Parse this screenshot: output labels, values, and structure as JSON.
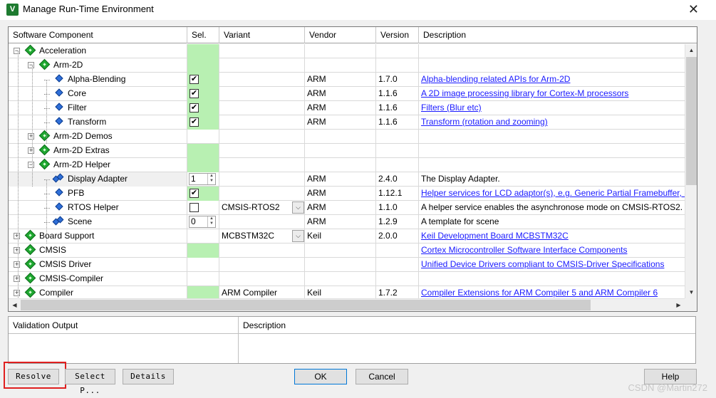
{
  "window": {
    "title": "Manage Run-Time Environment",
    "close_glyph": "✕"
  },
  "columns": [
    "Software Component",
    "Sel.",
    "Variant",
    "Vendor",
    "Version",
    "Description"
  ],
  "rows": [
    {
      "indent": 0,
      "expander": "-",
      "icon": "diamond",
      "name": "Acceleration",
      "sel": "green",
      "variant": "",
      "vendor": "",
      "version": "",
      "desc": "",
      "desc_link": false
    },
    {
      "indent": 1,
      "expander": "-",
      "icon": "diamond",
      "name": "Arm-2D",
      "sel": "green",
      "variant": "",
      "vendor": "",
      "version": "",
      "desc": "",
      "desc_link": false
    },
    {
      "indent": 2,
      "expander": "",
      "icon": "gem",
      "name": "Alpha-Blending",
      "sel": "check",
      "variant": "",
      "vendor": "ARM",
      "version": "1.7.0",
      "desc": "Alpha-blending related APIs for Arm-2D",
      "desc_link": true
    },
    {
      "indent": 2,
      "expander": "",
      "icon": "gem",
      "name": "Core",
      "sel": "check",
      "variant": "",
      "vendor": "ARM",
      "version": "1.1.6",
      "desc": "A 2D image processing library for Cortex-M processors",
      "desc_link": true
    },
    {
      "indent": 2,
      "expander": "",
      "icon": "gem",
      "name": "Filter",
      "sel": "check",
      "variant": "",
      "vendor": "ARM",
      "version": "1.1.6",
      "desc": "Filters (Blur etc)",
      "desc_link": true
    },
    {
      "indent": 2,
      "expander": "",
      "icon": "gem",
      "name": "Transform",
      "sel": "check",
      "variant": "",
      "vendor": "ARM",
      "version": "1.1.6",
      "desc": "Transform (rotation and zooming)",
      "desc_link": true
    },
    {
      "indent": 1,
      "expander": "+",
      "icon": "diamond",
      "name": "Arm-2D Demos",
      "sel": "",
      "variant": "",
      "vendor": "",
      "version": "",
      "desc": "",
      "desc_link": false
    },
    {
      "indent": 1,
      "expander": "+",
      "icon": "diamond",
      "name": "Arm-2D Extras",
      "sel": "green",
      "variant": "",
      "vendor": "",
      "version": "",
      "desc": "",
      "desc_link": false
    },
    {
      "indent": 1,
      "expander": "-",
      "icon": "diamond",
      "name": "Arm-2D Helper",
      "sel": "green",
      "variant": "",
      "vendor": "",
      "version": "",
      "desc": "",
      "desc_link": false
    },
    {
      "indent": 2,
      "expander": "",
      "icon": "gem2",
      "name": "Display Adapter",
      "sel": "spin",
      "spin": "1",
      "variant": "",
      "vendor": "ARM",
      "version": "2.4.0",
      "desc": "The Display Adapter.",
      "desc_link": false,
      "highlight": true
    },
    {
      "indent": 2,
      "expander": "",
      "icon": "gem",
      "name": "PFB",
      "sel": "check",
      "variant": "",
      "vendor": "ARM",
      "version": "1.12.1",
      "desc": "Helper services for LCD adaptor(s), e.g. Generic Partial Framebuffer, Sc",
      "desc_link": true
    },
    {
      "indent": 2,
      "expander": "",
      "icon": "gem",
      "name": "RTOS Helper",
      "sel": "uncheck",
      "variant": "CMSIS-RTOS2",
      "variant_combo": true,
      "vendor": "ARM",
      "version": "1.1.0",
      "desc": "A helper service enables the asynchronose mode on CMSIS-RTOS2.",
      "desc_link": false
    },
    {
      "indent": 2,
      "expander": "",
      "icon": "gem2",
      "name": "Scene",
      "sel": "spin",
      "spin": "0",
      "variant": "",
      "vendor": "ARM",
      "version": "1.2.9",
      "desc": "A template for scene",
      "desc_link": false
    },
    {
      "indent": 0,
      "expander": "+",
      "icon": "diamond",
      "name": "Board Support",
      "sel": "",
      "variant": "MCBSTM32C",
      "variant_combo": true,
      "vendor": "Keil",
      "version": "2.0.0",
      "desc": "Keil Development Board MCBSTM32C",
      "desc_link": true
    },
    {
      "indent": 0,
      "expander": "+",
      "icon": "diamond",
      "name": "CMSIS",
      "sel": "green",
      "variant": "",
      "vendor": "",
      "version": "",
      "desc": "Cortex Microcontroller Software Interface Components",
      "desc_link": true
    },
    {
      "indent": 0,
      "expander": "+",
      "icon": "diamond",
      "name": "CMSIS Driver",
      "sel": "",
      "variant": "",
      "vendor": "",
      "version": "",
      "desc": "Unified Device Drivers compliant to CMSIS-Driver Specifications",
      "desc_link": true
    },
    {
      "indent": 0,
      "expander": "+",
      "icon": "diamond",
      "name": "CMSIS-Compiler",
      "sel": "",
      "variant": "",
      "vendor": "",
      "version": "",
      "desc": "",
      "desc_link": false
    },
    {
      "indent": 0,
      "expander": "+",
      "icon": "diamond",
      "name": "Compiler",
      "sel": "green",
      "variant": "ARM Compiler",
      "vendor": "Keil",
      "version": "1.7.2",
      "desc": "Compiler Extensions for ARM Compiler 5 and ARM Compiler 6",
      "desc_link": true
    }
  ],
  "validation": {
    "output_header": "Validation Output",
    "description_header": "Description"
  },
  "buttons": {
    "resolve": "Resolve",
    "select_packs": "Select P...",
    "details": "Details",
    "ok": "OK",
    "cancel": "Cancel",
    "help": "Help"
  },
  "watermark": "CSDN @Martin272",
  "colors": {
    "selected_green": "#b8f0b2",
    "link_blue": "#1a1aff",
    "highlight_red": "#e02020"
  }
}
